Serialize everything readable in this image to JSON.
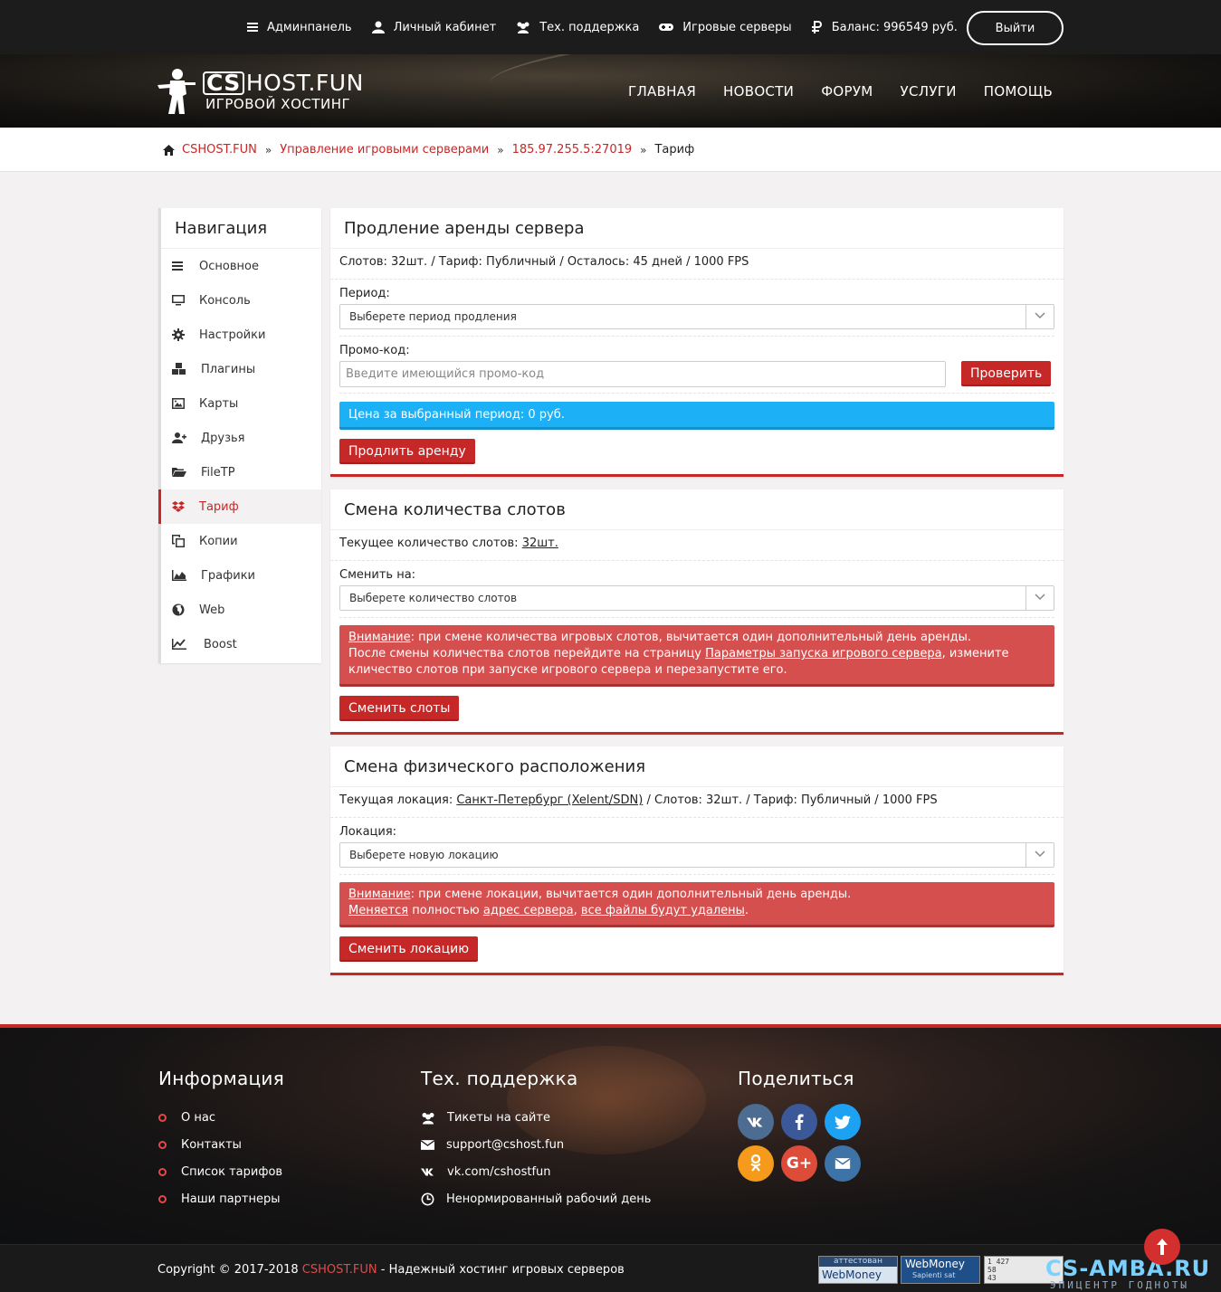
{
  "topbar": {
    "items": [
      {
        "label": "Админпанель",
        "icon": "list-icon"
      },
      {
        "label": "Личный кабинет",
        "icon": "user-icon"
      },
      {
        "label": "Тех. поддержка",
        "icon": "users-icon"
      },
      {
        "label": "Игровые серверы",
        "icon": "gamepad-icon"
      },
      {
        "label": "Баланс: 996549 руб.",
        "icon": "ruble-icon"
      }
    ],
    "logout": "Выйти"
  },
  "logo": {
    "cs": "CS",
    "name": "HOST.FUN",
    "tagline": "ИГРОВОЙ ХОСТИНГ"
  },
  "mainnav": [
    "ГЛАВНАЯ",
    "НОВОСТИ",
    "ФОРУМ",
    "УСЛУГИ",
    "ПОМОЩЬ"
  ],
  "breadcrumbs": {
    "home": "CSHOST.FUN",
    "servers": "Управление игровыми серверами",
    "server": "185.97.255.5:27019",
    "current": "Тариф"
  },
  "sidebar": {
    "title": "Навигация",
    "items": [
      {
        "label": "Основное",
        "icon": "bars-icon"
      },
      {
        "label": "Консоль",
        "icon": "monitor-icon"
      },
      {
        "label": "Настройки",
        "icon": "gear-icon"
      },
      {
        "label": "Плагины",
        "icon": "cubes-icon"
      },
      {
        "label": "Карты",
        "icon": "image-icon"
      },
      {
        "label": "Друзья",
        "icon": "user-plus-icon"
      },
      {
        "label": "FileTP",
        "icon": "folder-open-icon"
      },
      {
        "label": "Тариф",
        "icon": "dropbox-icon"
      },
      {
        "label": "Копии",
        "icon": "copy-icon"
      },
      {
        "label": "Графики",
        "icon": "area-chart-icon"
      },
      {
        "label": "Web",
        "icon": "globe-icon"
      },
      {
        "label": "Boost",
        "icon": "line-chart-icon"
      }
    ],
    "active_index": 7
  },
  "renew": {
    "title": "Продление аренды сервера",
    "status": "Слотов: 32шт. / Тариф: Публичный / Осталось: 45 дней / 1000 FPS",
    "period_label": "Период:",
    "period_placeholder": "Выберете период продления",
    "promo_label": "Промо-код:",
    "promo_placeholder": "Введите имеющийся промо-код",
    "check_button": "Проверить",
    "price": "Цена за выбранный период: 0 руб.",
    "submit": "Продлить аренду"
  },
  "slots": {
    "title": "Смена количества слотов",
    "current_prefix": "Текущее количество слотов: ",
    "current_value": "32шт.",
    "change_label": "Сменить на:",
    "select_placeholder": "Выберете количество слотов",
    "warn_title": "Внимание",
    "warn_text1": ": при смене количества игровых слотов, вычитается один дополнительный день аренды.",
    "warn_text2": "После смены количества слотов перейдите на страницу ",
    "warn_link": "Параметры запуска игрового сервера",
    "warn_text3": ", измените кличество слотов при запуске игрового сервера и перезапустите его.",
    "submit": "Сменить слоты"
  },
  "location": {
    "title": "Смена физического расположения",
    "current_prefix": "Текущая локация: ",
    "current_value": "Санкт-Петербург (Xelent/SDN)",
    "current_suffix": " / Слотов: 32шт. / Тариф: Публичный / 1000 FPS",
    "label": "Локация:",
    "select_placeholder": "Выберете новую локацию",
    "warn_title": "Внимание",
    "warn_text1": ": при смене локации, вычитается один дополнительный день аренды.",
    "warn_changes": "Меняется",
    "warn_mid": " полностью ",
    "warn_addr": "адрес сервера",
    "warn_comma": ", ",
    "warn_files": "все файлы будут удалены",
    "warn_end": ".",
    "submit": "Сменить локацию"
  },
  "footer": {
    "info_title": "Информация",
    "info_links": [
      "О нас",
      "Контакты",
      "Список тарифов",
      "Наши партнеры"
    ],
    "support_title": "Тех. поддержка",
    "support_items": [
      {
        "label": "Тикеты на сайте",
        "icon": "users-icon"
      },
      {
        "label": "support@cshost.fun",
        "icon": "envelope-icon"
      },
      {
        "label": "vk.com/cshostfun",
        "icon": "vk-icon"
      },
      {
        "label": "Ненормированный рабочий день",
        "icon": "clock-icon"
      }
    ],
    "share_title": "Поделиться",
    "share": [
      {
        "name": "vk-icon",
        "color": "#4c6c91"
      },
      {
        "name": "facebook-icon",
        "color": "#3b5998"
      },
      {
        "name": "twitter-icon",
        "color": "#1da1f2"
      },
      {
        "name": "odnoklassniki-icon",
        "color": "#f59a1b"
      },
      {
        "name": "google-plus-icon",
        "color": "#dd4b39"
      },
      {
        "name": "envelope-icon",
        "color": "#3e73a8"
      }
    ]
  },
  "bottom": {
    "copy_prefix": "Copyright © 2017-2018 ",
    "copy_brand": "CSHOST.FUN",
    "copy_suffix": " - Надежный хостинг игровых серверов",
    "wm_attest_top": "аттестован",
    "wm_attest_bottom": "WebMoney",
    "wm_sapienti": "WebMoney",
    "wm_sapienti_sub": "Sapienti sat",
    "counter": "1 427\n58\n43",
    "watermark": "CS-AMBA.RU",
    "watermark_sub": "ЭПИЦЕНТР ГОДНОТЫ"
  }
}
